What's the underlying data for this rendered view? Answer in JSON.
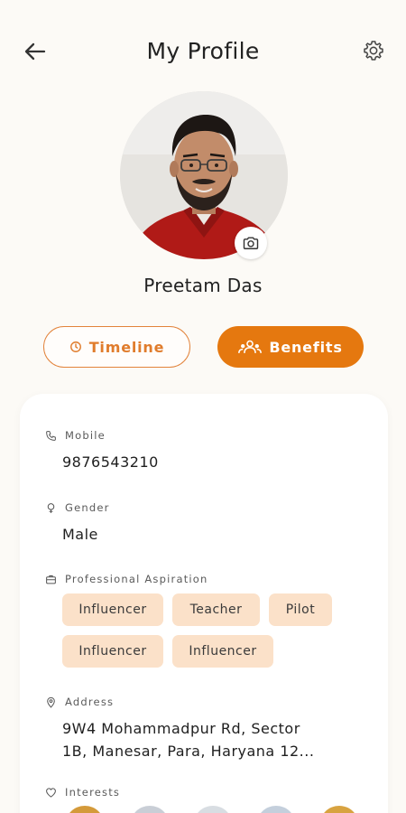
{
  "header": {
    "title": "My Profile"
  },
  "profile": {
    "name": "Preetam Das"
  },
  "tabs": {
    "timeline": "Timeline",
    "benefits": "Benefits"
  },
  "fields": {
    "mobile": {
      "label": "Mobile",
      "value": "9876543210"
    },
    "gender": {
      "label": "Gender",
      "value": "Male"
    },
    "aspiration": {
      "label": "Professional Aspiration",
      "chips": [
        "Influencer",
        "Teacher",
        "Pilot",
        "Influencer",
        "Influencer"
      ]
    },
    "address": {
      "label": "Address",
      "line1": "9W4 Mohammadpur Rd, Sector",
      "line2": "1B, Manesar, Para, Haryana 12..."
    },
    "interests": {
      "label": "Interests"
    }
  },
  "colors": {
    "accent": "#e5780f",
    "accent_outline": "#e2833b",
    "chip_bg": "#fbe1c9",
    "background": "#fcfaf6"
  }
}
